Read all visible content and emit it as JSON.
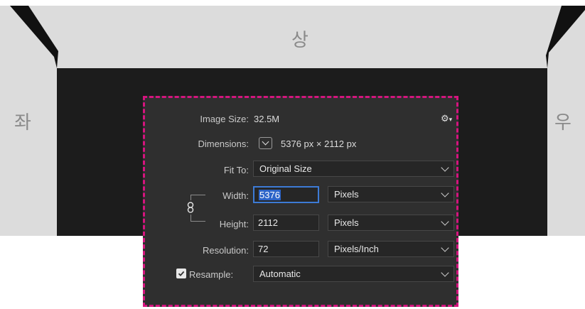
{
  "edges": {
    "top": "상",
    "left": "좌",
    "right": "우"
  },
  "dialog": {
    "image_size_label": "Image Size:",
    "image_size_value": "32.5M",
    "dimensions_label": "Dimensions:",
    "dimensions_value": "5376 px  ×  2112 px",
    "fit_to_label": "Fit To:",
    "fit_to_value": "Original Size",
    "width_label": "Width:",
    "width_value": "5376",
    "width_unit": "Pixels",
    "height_label": "Height:",
    "height_value": "2112",
    "height_unit": "Pixels",
    "resolution_label": "Resolution:",
    "resolution_value": "72",
    "resolution_unit": "Pixels/Inch",
    "resample_label": "Resample:",
    "resample_checked": true,
    "resample_value": "Automatic"
  },
  "colors": {
    "dialog_bg": "#2f2f2f",
    "highlight_border": "#d4147e",
    "selection": "#2c64c8",
    "frame_gray": "#dedede",
    "canvas_dark": "#1c1c1c"
  },
  "icons": [
    "gear-icon",
    "chevron-down-icon",
    "link-icon",
    "checkbox-icon"
  ]
}
